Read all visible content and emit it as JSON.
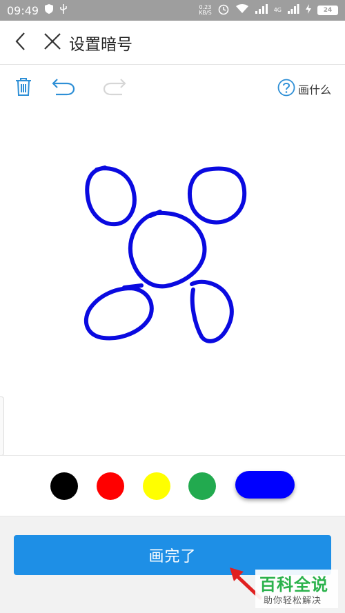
{
  "status_bar": {
    "time": "09:49",
    "net_speed_value": "0.23",
    "net_speed_unit": "KB/S",
    "signal_label": "4G",
    "battery": "24"
  },
  "header": {
    "title": "设置暗号",
    "back_icon": "chevron-left-icon",
    "close_icon": "close-icon"
  },
  "toolbar": {
    "delete_icon": "trash-icon",
    "undo_icon": "undo-icon",
    "redo_icon": "redo-icon",
    "redo_enabled": false,
    "help_label": "画什么",
    "help_icon": "question-circle-icon"
  },
  "drawing": {
    "stroke_color": "#0a0ae0",
    "shapes": [
      "circle",
      "circle",
      "circle",
      "oval",
      "oval"
    ]
  },
  "palette": {
    "colors": [
      {
        "name": "black",
        "hex": "#000000"
      },
      {
        "name": "red",
        "hex": "#ff0000"
      },
      {
        "name": "yellow",
        "hex": "#ffff00"
      },
      {
        "name": "green",
        "hex": "#22aa4f"
      },
      {
        "name": "blue",
        "hex": "#0000ff"
      }
    ],
    "selected": "blue"
  },
  "actions": {
    "done_label": "画完了",
    "accent": "#1e8fe6"
  },
  "watermark": {
    "title": "百科全说",
    "subtitle": "助你轻松解决"
  }
}
